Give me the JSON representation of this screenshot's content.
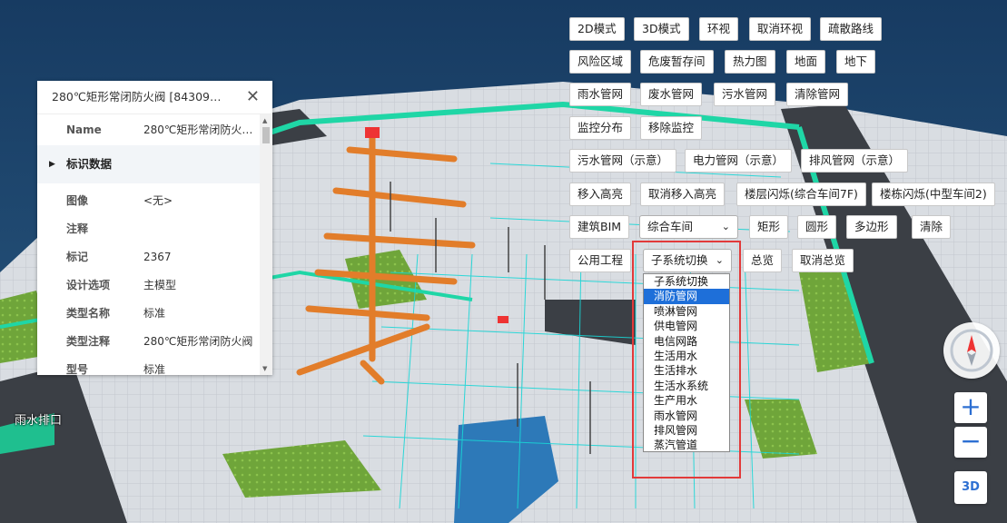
{
  "toolbar": {
    "row1": [
      "2D模式",
      "3D模式",
      "环视",
      "取消环视",
      "疏散路线"
    ],
    "row2": [
      "风险区域",
      "危废暂存间",
      "热力图",
      "地面",
      "地下"
    ],
    "row3": [
      "雨水管网",
      "废水管网",
      "污水管网",
      "清除管网"
    ],
    "row4": [
      "监控分布",
      "移除监控"
    ],
    "row5": [
      "污水管网（示意）",
      "电力管网（示意）",
      "排风管网（示意）"
    ],
    "row6": [
      "移入高亮",
      "取消移入高亮",
      "楼层闪烁(综合车间7F)",
      "楼栋闪烁(中型车间2)"
    ],
    "row7": {
      "bim": "建筑BIM",
      "building_select": "综合车间",
      "rect": "矩形",
      "circle": "圆形",
      "polygon": "多边形",
      "clear": "清除"
    },
    "row8": {
      "utility": "公用工程",
      "subsystem_select": "子系统切换",
      "overview": "总览",
      "cancel_overview": "取消总览"
    }
  },
  "subsystem_options": [
    "子系统切换",
    "消防管网",
    "喷淋管网",
    "供电管网",
    "电信网路",
    "生活用水",
    "生活排水",
    "生活水系统",
    "生产用水",
    "雨水管网",
    "排风管网",
    "蒸汽管道"
  ],
  "subsystem_selected_index": 1,
  "properties": {
    "title": "280℃矩形常闭防火阀 [84309…",
    "name_key": "Name",
    "name_value": "280℃矩形常闭防火…",
    "section": "标识数据",
    "rows": [
      {
        "k": "图像",
        "v": "<无>"
      },
      {
        "k": "注释",
        "v": ""
      },
      {
        "k": "标记",
        "v": "2367"
      },
      {
        "k": "设计选项",
        "v": "主模型"
      },
      {
        "k": "类型名称",
        "v": "标准"
      },
      {
        "k": "类型注释",
        "v": "280℃矩形常闭防火阀"
      },
      {
        "k": "型号",
        "v": "标准"
      }
    ]
  },
  "map": {
    "label": "雨水排口",
    "zoom_in": "+",
    "zoom_out": "−",
    "view_mode": "3D"
  },
  "colors": {
    "highlight_frame": "#e23a3a",
    "accent": "#2d6fd2",
    "pipe_cyan": "#19d6d6",
    "pipe_orange": "#e27d2a"
  }
}
